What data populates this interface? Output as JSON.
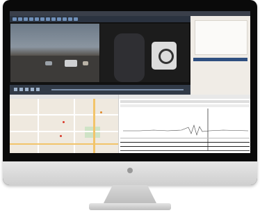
{
  "window": {
    "title": ""
  },
  "toolbar": {
    "icons": [
      "play-icon",
      "pause-icon",
      "stop-icon",
      "folder-icon",
      "save-icon",
      "camera-icon",
      "map-icon",
      "chart-icon",
      "settings-icon",
      "grid-icon",
      "layout-icon",
      "help-icon"
    ]
  },
  "map_panel": {
    "title": ""
  },
  "graph_panel": {
    "title": ""
  },
  "colors": {
    "titlebar": "#3a3f4a",
    "toolbar": "#2b3340",
    "selection": "#2f4f80",
    "highway": "#f2c46a"
  }
}
